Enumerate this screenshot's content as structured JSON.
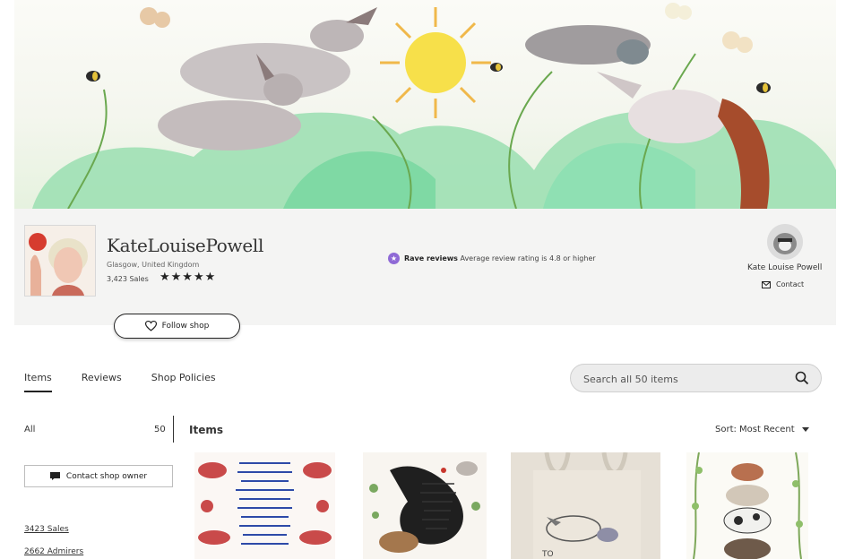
{
  "shop": {
    "name": "KateLouisePowell",
    "location": "Glasgow, United Kingdom",
    "sales": "3,423 Sales",
    "stars": "★★★★★"
  },
  "rave": {
    "title": "Rave reviews",
    "text": "Average review rating is 4.8 or higher"
  },
  "owner": {
    "name": "Kate Louise Powell",
    "contact_label": "Contact"
  },
  "follow_label": "Follow shop",
  "tabs": [
    {
      "label": "Items",
      "active": true
    },
    {
      "label": "Reviews",
      "active": false
    },
    {
      "label": "Shop Policies",
      "active": false
    }
  ],
  "search": {
    "placeholder": "Search all 50 items"
  },
  "sidebar": {
    "all_label": "All",
    "all_count": "50",
    "contact_label": "Contact shop owner",
    "sales_link": "3423 Sales",
    "admirers_link": "2662 Admirers"
  },
  "items_heading": "Items",
  "sort_label": "Sort: Most Recent",
  "colors": {
    "rave_badge": "#8f6ad6",
    "band_bg": "#f4f4f3"
  }
}
